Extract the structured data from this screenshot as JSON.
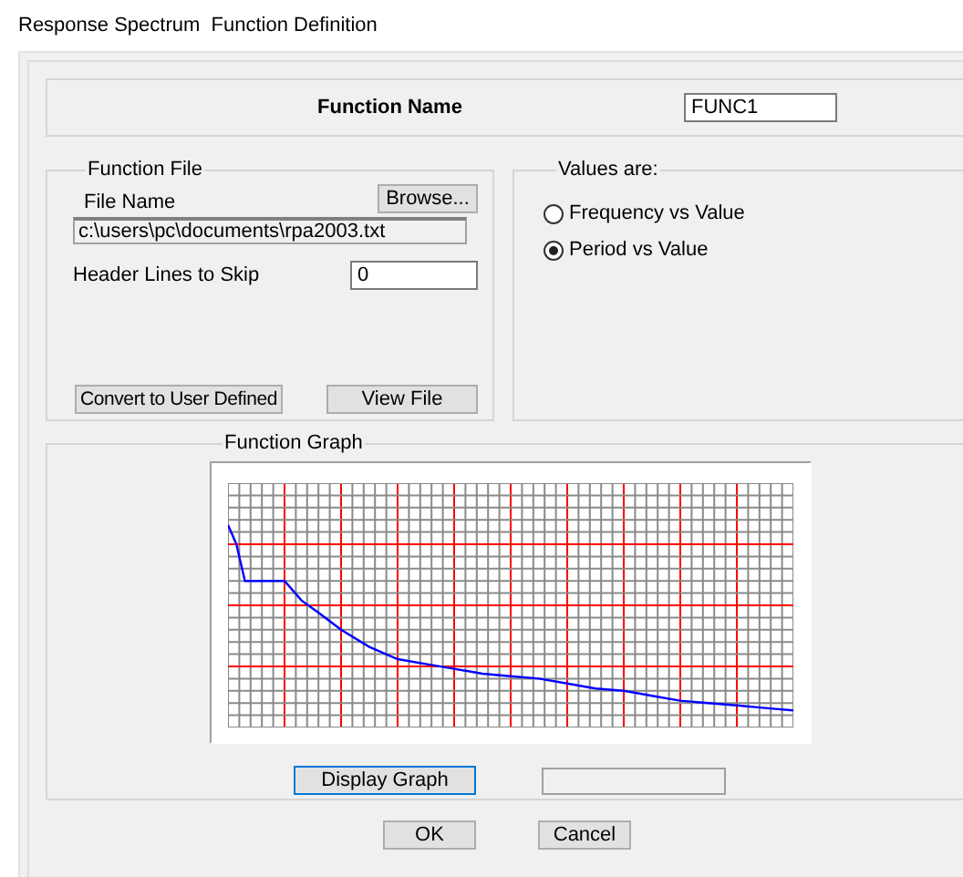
{
  "window": {
    "title": "Response Spectrum  Function Definition"
  },
  "function_name": {
    "label": "Function Name",
    "value": "FUNC1"
  },
  "function_file": {
    "title": "Function File",
    "file_name_label": "File Name",
    "browse_button": "Browse...",
    "file_path": "c:\\users\\pc\\documents\\rpa2003.txt",
    "header_lines_label": "Header Lines to Skip",
    "header_lines_value": "0",
    "convert_button": "Convert to User Defined",
    "view_button": "View File"
  },
  "values_are": {
    "title": "Values are:",
    "options": [
      {
        "label": "Frequency vs Value",
        "selected": false
      },
      {
        "label": "Period vs Value",
        "selected": true
      }
    ]
  },
  "function_graph": {
    "title": "Function Graph",
    "display_button": "Display Graph"
  },
  "buttons": [
    "OK",
    "Cancel"
  ]
}
